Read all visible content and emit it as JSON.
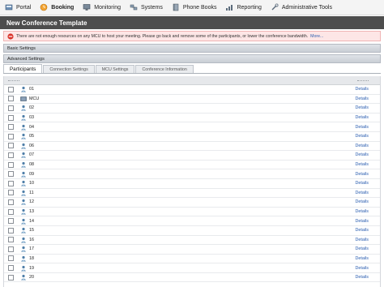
{
  "nav": [
    {
      "label": "Portal",
      "icon": "portal-icon"
    },
    {
      "label": "Booking",
      "icon": "booking-icon",
      "active": true
    },
    {
      "label": "Monitoring",
      "icon": "monitoring-icon"
    },
    {
      "label": "Systems",
      "icon": "systems-icon"
    },
    {
      "label": "Phone Books",
      "icon": "phone-books-icon"
    },
    {
      "label": "Reporting",
      "icon": "reporting-icon"
    },
    {
      "label": "Administrative Tools",
      "icon": "administrative-tools-icon"
    }
  ],
  "page_title": "New Conference Template",
  "warning": {
    "text": "There are not enough resources on any MCU to host your meeting. Please go back and remove some of the participants, or lower the conference bandwidth.",
    "more": "More..."
  },
  "sections": {
    "basic": "Basic Settings",
    "advanced": "Advanced Settings"
  },
  "tabs": [
    "Participants",
    "Connection Settings",
    "MCU Settings",
    "Conference Information"
  ],
  "participants": [
    {
      "name": "01",
      "type": "participant"
    },
    {
      "name": "MCU",
      "type": "mcu"
    },
    {
      "name": "02",
      "type": "participant"
    },
    {
      "name": "03",
      "type": "participant"
    },
    {
      "name": "04",
      "type": "participant"
    },
    {
      "name": "05",
      "type": "participant"
    },
    {
      "name": "06",
      "type": "participant"
    },
    {
      "name": "07",
      "type": "participant"
    },
    {
      "name": "08",
      "type": "participant"
    },
    {
      "name": "09",
      "type": "participant"
    },
    {
      "name": "10",
      "type": "participant"
    },
    {
      "name": "11",
      "type": "participant"
    },
    {
      "name": "12",
      "type": "participant"
    },
    {
      "name": "13",
      "type": "participant"
    },
    {
      "name": "14",
      "type": "participant"
    },
    {
      "name": "15",
      "type": "participant"
    },
    {
      "name": "16",
      "type": "participant"
    },
    {
      "name": "17",
      "type": "participant"
    },
    {
      "name": "18",
      "type": "participant"
    },
    {
      "name": "19",
      "type": "participant"
    },
    {
      "name": "20",
      "type": "participant"
    }
  ],
  "details_label": "Details",
  "colors": {
    "title_bar": "#4d4d4d",
    "warning_bg": "#fde6e6",
    "link": "#2a5db0"
  }
}
